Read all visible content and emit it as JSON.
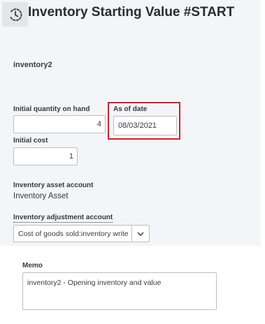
{
  "header": {
    "title": "Inventory Starting Value  #START",
    "icon": "history-clock-icon"
  },
  "item": {
    "name": "inventory2"
  },
  "fields": {
    "initial_quantity_label": "Initial quantity on hand",
    "initial_quantity_value": "4",
    "as_of_date_label": "As of date",
    "as_of_date_value": "08/03/2021",
    "initial_cost_label": "Initial cost",
    "initial_cost_value": "1",
    "inventory_asset_account_label": "Inventory asset account",
    "inventory_asset_account_value": "Inventory Asset",
    "inventory_adjustment_account_label": "Inventory adjustment account",
    "inventory_adjustment_account_value": "Cost of goods sold:inventory write"
  },
  "memo": {
    "label": "Memo",
    "value": "inventory2 - Opening inventory and value"
  },
  "colors": {
    "highlight": "#d5202b",
    "panel_bg": "#f4f5f8",
    "icon_bg": "#e3e5e8"
  }
}
